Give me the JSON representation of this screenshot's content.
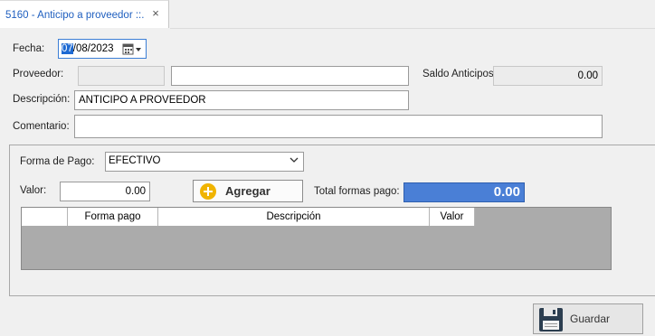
{
  "tab": {
    "title": "5160 - Anticipo a proveedor ::.",
    "close_icon": "×"
  },
  "form": {
    "fecha_label": "Fecha:",
    "fecha_day": "07",
    "fecha_rest": "/08/2023",
    "proveedor_label": "Proveedor:",
    "proveedor_code": "",
    "proveedor_name": "",
    "saldo_label": "Saldo Anticipos:",
    "saldo_value": "0.00",
    "descripcion_label": "Descripción:",
    "descripcion_value": "ANTICIPO A PROVEEDOR",
    "comentario_label": "Comentario:",
    "comentario_value": ""
  },
  "payment": {
    "forma_label": "Forma de Pago:",
    "forma_value": "EFECTIVO",
    "valor_label": "Valor:",
    "valor_value": "0.00",
    "agregar_label": "Agregar",
    "total_label": "Total formas pago:",
    "total_value": "0.00"
  },
  "grid": {
    "columns": [
      "",
      "Forma pago",
      "Descripción",
      "Valor"
    ]
  },
  "footer": {
    "guardar_label": "Guardar"
  },
  "colors": {
    "accent": "#1e6ad3",
    "total_bg": "#4a7fd6",
    "grid_bg": "#ababab",
    "plus_icon": "#f0b400"
  }
}
